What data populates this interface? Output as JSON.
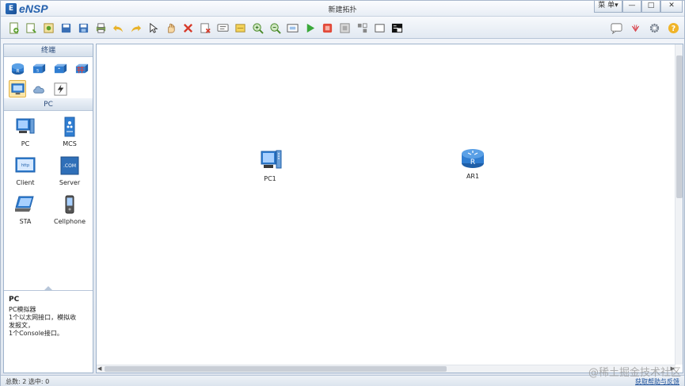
{
  "app": {
    "logo": "eNSP",
    "window_title": "新建拓扑",
    "menu_label": "菜 单▾",
    "minimize": "—",
    "maximize": "□",
    "close": "✕"
  },
  "toolbar": {
    "left_icons": [
      "new-topology-icon",
      "new-tab-icon",
      "open-icon",
      "save-icon",
      "save-as-icon",
      "print-icon",
      "undo-icon",
      "redo-icon",
      "select-icon",
      "pan-icon",
      "delete-icon",
      "delete-link-icon",
      "text-note-icon",
      "shape-icon",
      "zoom-in-icon",
      "zoom-out-icon",
      "fit-view-icon",
      "start-device-icon",
      "stop-device-icon",
      "capture-icon",
      "fullscreen-icon",
      "topology-icon",
      "terminal-icon"
    ],
    "right_icons": [
      "chat-icon",
      "huawei-icon",
      "settings-icon",
      "help-icon"
    ]
  },
  "left_panel": {
    "category_header": "终端",
    "categories": [
      "router-icon",
      "switch-icon",
      "wlan-icon",
      "firewall-icon",
      "terminal-device-icon",
      "cloud-icon",
      "connection-icon"
    ],
    "selected_category": "terminal-device-icon",
    "device_header": "PC",
    "devices": [
      {
        "label": "PC",
        "icon": "pc-icon"
      },
      {
        "label": "MCS",
        "icon": "mcs-icon"
      },
      {
        "label": "Client",
        "icon": "client-icon"
      },
      {
        "label": "Server",
        "icon": "server-icon"
      },
      {
        "label": "STA",
        "icon": "sta-icon"
      },
      {
        "label": "Cellphone",
        "icon": "cellphone-icon"
      }
    ],
    "description": {
      "title": "PC",
      "lines": [
        "PC模拟器",
        "1个以太网接口，模拟收",
        "发报文，",
        "1个Console接口。"
      ]
    }
  },
  "canvas": {
    "nodes": [
      {
        "label": "PC1",
        "icon": "pc-icon"
      },
      {
        "label": "AR1",
        "icon": "router-icon"
      }
    ]
  },
  "status": {
    "count_text": "总数: 2  选中: 0",
    "help_link": "获取帮助与反馈"
  },
  "watermark": "@稀土掘金技术社区",
  "colors": {
    "accent": "#2561ad",
    "router": "#2f7dd1",
    "selected": "#fde7a8"
  }
}
